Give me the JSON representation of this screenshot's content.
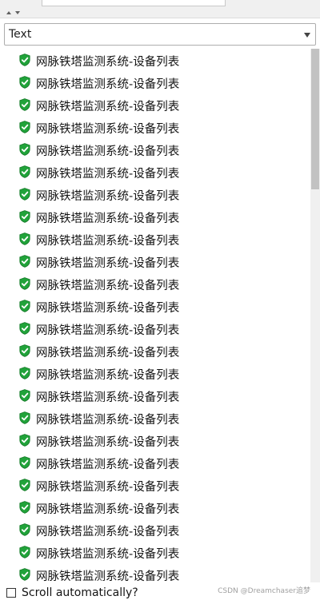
{
  "source_dropdown": {
    "value": "Text"
  },
  "device_list": {
    "items": [
      {
        "label": "网脉铁塔监测系统-设备列表"
      },
      {
        "label": "网脉铁塔监测系统-设备列表"
      },
      {
        "label": "网脉铁塔监测系统-设备列表"
      },
      {
        "label": "网脉铁塔监测系统-设备列表"
      },
      {
        "label": "网脉铁塔监测系统-设备列表"
      },
      {
        "label": "网脉铁塔监测系统-设备列表"
      },
      {
        "label": "网脉铁塔监测系统-设备列表"
      },
      {
        "label": "网脉铁塔监测系统-设备列表"
      },
      {
        "label": "网脉铁塔监测系统-设备列表"
      },
      {
        "label": "网脉铁塔监测系统-设备列表"
      },
      {
        "label": "网脉铁塔监测系统-设备列表"
      },
      {
        "label": "网脉铁塔监测系统-设备列表"
      },
      {
        "label": "网脉铁塔监测系统-设备列表"
      },
      {
        "label": "网脉铁塔监测系统-设备列表"
      },
      {
        "label": "网脉铁塔监测系统-设备列表"
      },
      {
        "label": "网脉铁塔监测系统-设备列表"
      },
      {
        "label": "网脉铁塔监测系统-设备列表"
      },
      {
        "label": "网脉铁塔监测系统-设备列表"
      },
      {
        "label": "网脉铁塔监测系统-设备列表"
      },
      {
        "label": "网脉铁塔监测系统-设备列表"
      },
      {
        "label": "网脉铁塔监测系统-设备列表"
      },
      {
        "label": "网脉铁塔监测系统-设备列表"
      },
      {
        "label": "网脉铁塔监测系统-设备列表"
      },
      {
        "label": "网脉铁塔监测系统-设备列表"
      }
    ],
    "item_icon": "green-shield-check-icon"
  },
  "scroll_option": {
    "label": "Scroll automatically?",
    "checked": false
  },
  "watermark": "CSDN @Dreamchaser追梦",
  "colors": {
    "shield_green": "#21a33a",
    "scroll_thumb": "#c2c2c2"
  }
}
